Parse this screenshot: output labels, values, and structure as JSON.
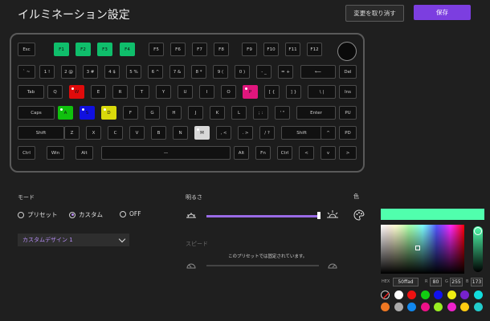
{
  "header": {
    "title": "イルミネーション設定",
    "revert_label": "変更を取り消す",
    "save_label": "保存"
  },
  "keyboard": {
    "rows": [
      [
        {
          "l": "Esc"
        },
        {
          "l": "F1",
          "c": "#0fbe6b"
        },
        {
          "l": "F2",
          "c": "#0fbe6b"
        },
        {
          "l": "F3",
          "c": "#0fbe6b"
        },
        {
          "l": "F4",
          "c": "#0fbe6b"
        },
        {
          "l": "F5"
        },
        {
          "l": "F6"
        },
        {
          "l": "F7"
        },
        {
          "l": "F8"
        },
        {
          "l": "F9"
        },
        {
          "l": "F10"
        },
        {
          "l": "F11"
        },
        {
          "l": "F12"
        }
      ],
      [
        {
          "l": "` ~"
        },
        {
          "l": "1 !"
        },
        {
          "l": "2 @"
        },
        {
          "l": "3 #"
        },
        {
          "l": "4 $"
        },
        {
          "l": "5 %"
        },
        {
          "l": "6 ^"
        },
        {
          "l": "7 &"
        },
        {
          "l": "8 *"
        },
        {
          "l": "9 ("
        },
        {
          "l": "0 )"
        },
        {
          "l": "- _"
        },
        {
          "l": "= +"
        },
        {
          "l": "⟵"
        },
        {
          "l": "Del"
        }
      ],
      [
        {
          "l": "Tab"
        },
        {
          "l": "Q"
        },
        {
          "l": "W",
          "c": "#e00b0b",
          "d": true
        },
        {
          "l": "E"
        },
        {
          "l": "R"
        },
        {
          "l": "T"
        },
        {
          "l": "Y"
        },
        {
          "l": "U"
        },
        {
          "l": "I"
        },
        {
          "l": "O"
        },
        {
          "l": "P",
          "c": "#e0167d",
          "d": true
        },
        {
          "l": "[ {"
        },
        {
          "l": "] }"
        },
        {
          "l": "\\ |"
        },
        {
          "l": "Ins"
        }
      ],
      [
        {
          "l": "Caps"
        },
        {
          "l": "A",
          "c": "#10c10e",
          "d": true
        },
        {
          "l": "S",
          "c": "#1010e0",
          "d": true
        },
        {
          "l": "D",
          "c": "#d9d90b",
          "d": true
        },
        {
          "l": "F"
        },
        {
          "l": "G"
        },
        {
          "l": "H"
        },
        {
          "l": "J"
        },
        {
          "l": "K"
        },
        {
          "l": "L"
        },
        {
          "l": "; :"
        },
        {
          "l": "' \""
        },
        {
          "l": "Enter"
        },
        {
          "l": "PU"
        }
      ],
      [
        {
          "l": "Shift"
        },
        {
          "l": "Z"
        },
        {
          "l": "X"
        },
        {
          "l": "C"
        },
        {
          "l": "V"
        },
        {
          "l": "B"
        },
        {
          "l": "N"
        },
        {
          "l": "M",
          "c": "#d8d8d8",
          "d": true
        },
        {
          "l": ", <"
        },
        {
          "l": ". >"
        },
        {
          "l": "/ ?"
        },
        {
          "l": "Shift"
        },
        {
          "l": "^"
        },
        {
          "l": "PD"
        }
      ],
      [
        {
          "l": "Ctrl"
        },
        {
          "l": "Win"
        },
        {
          "l": "Alt"
        },
        {
          "l": "—"
        },
        {
          "l": "Alt"
        },
        {
          "l": "Fn"
        },
        {
          "l": "Ctrl"
        },
        {
          "l": "<"
        },
        {
          "l": "v"
        },
        {
          "l": ">"
        }
      ]
    ]
  },
  "mode": {
    "label": "モード",
    "options": [
      {
        "label": "プリセット",
        "selected": false
      },
      {
        "label": "カスタム",
        "selected": true
      },
      {
        "label": "OFF",
        "selected": false
      }
    ],
    "dropdown_value": "カスタムデザイン 1"
  },
  "brightness": {
    "label": "明るさ",
    "level": 1.0
  },
  "speed": {
    "label": "スピード",
    "disabled_note": "このプリセットでは固定されています。"
  },
  "color": {
    "label": "色",
    "current": "#50ffad",
    "hex_label": "HEX",
    "hex_value": "50ffad",
    "r_label": "R",
    "r_value": "80",
    "g_label": "G",
    "g_value": "255",
    "b_label": "B",
    "b_value": "173",
    "swatches": [
      "none",
      "#ffffff",
      "#ee1111",
      "#11cc11",
      "#1111ee",
      "#eeee11",
      "#7722cc",
      "#11dddd",
      "#ee7722",
      "#aaaaaa",
      "#1188ee",
      "#ee1188",
      "#99ee22",
      "#ee22cc",
      "#ffcc11",
      "#22cccc"
    ]
  }
}
